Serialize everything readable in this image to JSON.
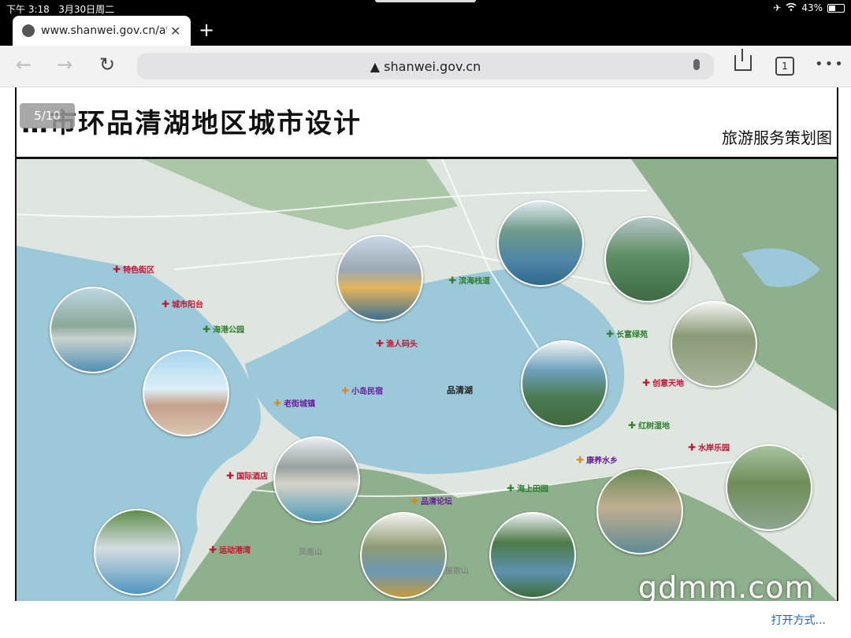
{
  "status": {
    "time": "下午 3:18",
    "date": "3月30日周二",
    "battery": "43%",
    "airplane_icon": "✈",
    "wifi_icon": "wifi"
  },
  "tab": {
    "title": "www.shanwei.gov.cn/atta",
    "close": "✕",
    "new_tab": "+"
  },
  "nav": {
    "back": "←",
    "forward": "→",
    "reload": "↻",
    "address": "▲ shanwei.gov.cn",
    "tabs_count": "1",
    "more": "•••"
  },
  "doc": {
    "title": "…市环品清湖地区城市设计",
    "subtitle": "旅游服务策划图",
    "counter": "5/10"
  },
  "map": {
    "lake_label": "品清湖",
    "labels": [
      {
        "text": "特色街区",
        "type": "red"
      },
      {
        "text": "城市阳台",
        "type": "red"
      },
      {
        "text": "海港公园",
        "type": "green"
      },
      {
        "text": "渔人码头",
        "type": "red"
      },
      {
        "text": "滨海栈道",
        "type": "green"
      },
      {
        "text": "长富绿苑",
        "type": "green"
      },
      {
        "text": "老街城镇",
        "type": "orange"
      },
      {
        "text": "小岛民宿",
        "type": "orange"
      },
      {
        "text": "创意天地",
        "type": "red"
      },
      {
        "text": "红树湿地",
        "type": "green"
      },
      {
        "text": "水岸乐园",
        "type": "red"
      },
      {
        "text": "康养水乡",
        "type": "orange"
      },
      {
        "text": "国际酒店",
        "type": "red"
      },
      {
        "text": "海上田园",
        "type": "green"
      },
      {
        "text": "品清论坛",
        "type": "orange"
      },
      {
        "text": "运动港湾",
        "type": "red"
      },
      {
        "text": "凤凰山",
        "type": "grey"
      },
      {
        "text": "屋歌山",
        "type": "grey"
      }
    ]
  },
  "bottom": {
    "open_with": "打开方式..."
  },
  "watermark": "gdmm.com",
  "colors": {
    "lake": "#9cc9d9",
    "land": "#dfe6df",
    "hills": "#8fb08c",
    "red": "#c8102e",
    "green": "#2e7d32",
    "link": "#1565c0"
  }
}
